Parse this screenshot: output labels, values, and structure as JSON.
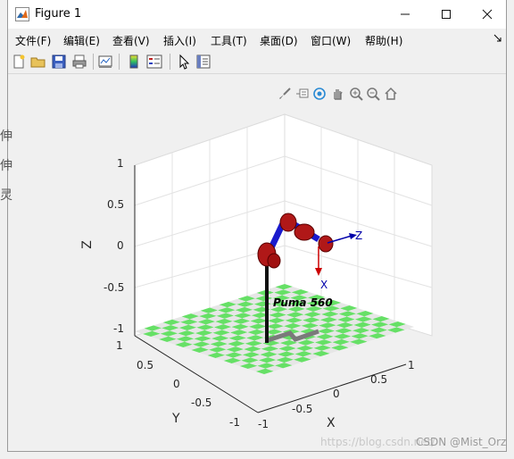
{
  "window": {
    "title": "Figure 1",
    "minimize_icon": "minimize-icon",
    "maximize_icon": "maximize-icon",
    "close_icon": "close-icon"
  },
  "menu": {
    "items": [
      "文件(F)",
      "编辑(E)",
      "查看(V)",
      "插入(I)",
      "工具(T)",
      "桌面(D)",
      "窗口(W)",
      "帮助(H)"
    ],
    "dock_icon": "dock-arrow-icon"
  },
  "toolbar": {
    "icons": [
      "new-figure-icon",
      "open-file-icon",
      "save-icon",
      "print-icon",
      "link-plot-icon",
      "colorbar-icon",
      "legend-icon",
      "pointer-icon",
      "property-inspector-icon"
    ]
  },
  "axes_toolbar": {
    "icons": [
      "brush-icon",
      "data-tips-icon",
      "rotate-3d-icon",
      "pan-icon",
      "zoom-in-icon",
      "zoom-out-icon",
      "home-icon"
    ]
  },
  "side_glyphs": [
    "伸",
    "伸",
    "灵"
  ],
  "plot": {
    "z_ticks": [
      "1",
      "0.5",
      "0",
      "-0.5",
      "-1"
    ],
    "y_ticks": [
      "1",
      "0.5",
      "0",
      "-0.5",
      "-1"
    ],
    "x_ticks": [
      "-1",
      "-0.5",
      "0",
      "0.5",
      "1"
    ],
    "xlabel": "X",
    "ylabel": "Y",
    "zlabel": "Z",
    "robot_name": "Puma 560",
    "frame_labels": {
      "z": "Z",
      "x": "X"
    },
    "colors": {
      "floor_green": "#66e066",
      "floor_light": "#e6e6e6",
      "link_red": "#b01818",
      "link_blue": "#1a1acc",
      "frame_blue": "#0000aa",
      "frame_red": "#cc0000"
    }
  },
  "watermark": {
    "faded": "https://blog.csdn.net/",
    "author": "CSDN @Mist_Orz"
  }
}
